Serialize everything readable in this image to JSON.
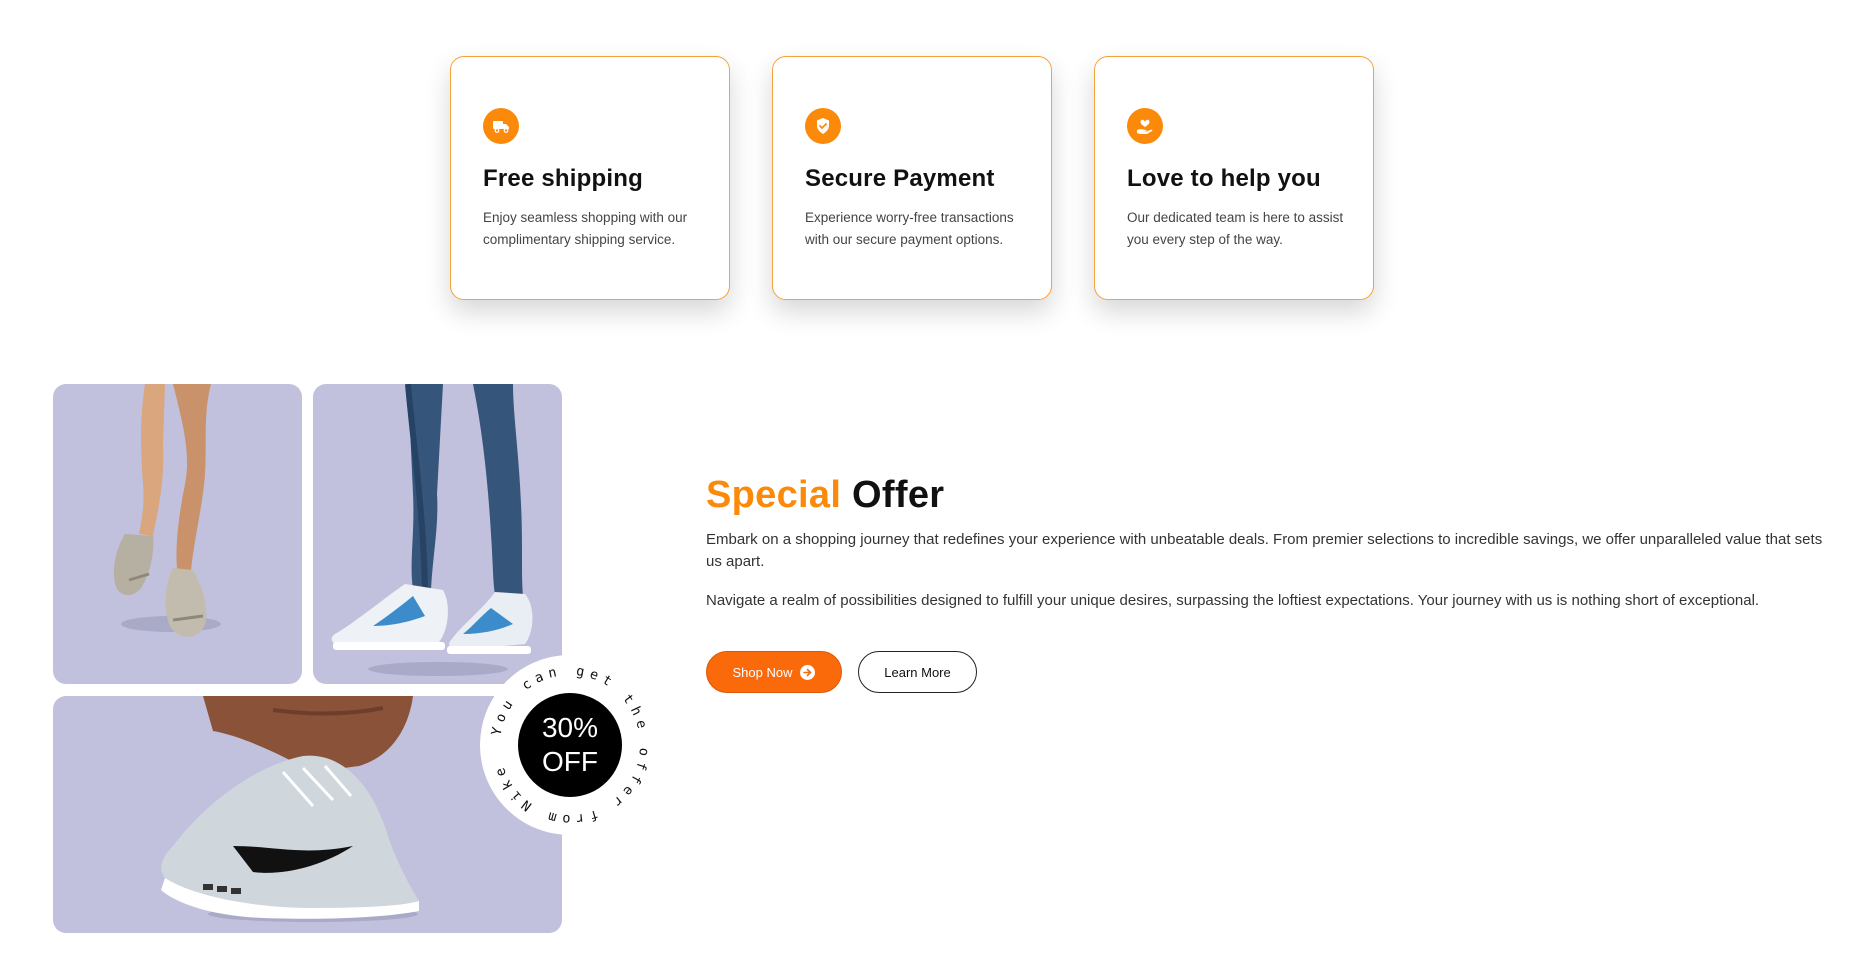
{
  "features": [
    {
      "icon": "delivery-truck-icon",
      "title": "Free shipping",
      "desc": "Enjoy seamless shopping with our complimentary shipping service."
    },
    {
      "icon": "shield-check-icon",
      "title": "Secure Payment",
      "desc": "Experience worry-free transactions with our secure payment options."
    },
    {
      "icon": "heart-hand-icon",
      "title": "Love to help you",
      "desc": "Our dedicated team is here to assist you every step of the way."
    }
  ],
  "badge": {
    "percent": "30%",
    "off": "OFF",
    "ring_text": "You can get the offer from Nike "
  },
  "offer": {
    "title_accent": "Special",
    "title_rest": "Offer",
    "para1": "Embark on a shopping journey that redefines your experience with unbeatable deals. From premier selections to incredible savings, we offer unparalleled value that sets us apart.",
    "para2": "Navigate a realm of possibilities designed to fulfill your unique desires, surpassing the loftiest expectations. Your journey with us is nothing short of exceptional.",
    "shop_now": "Shop Now",
    "learn_more": "Learn More"
  },
  "colors": {
    "accent": "#fb8a0a",
    "button": "#fb6a0a",
    "tile": "#c1c1dd"
  }
}
